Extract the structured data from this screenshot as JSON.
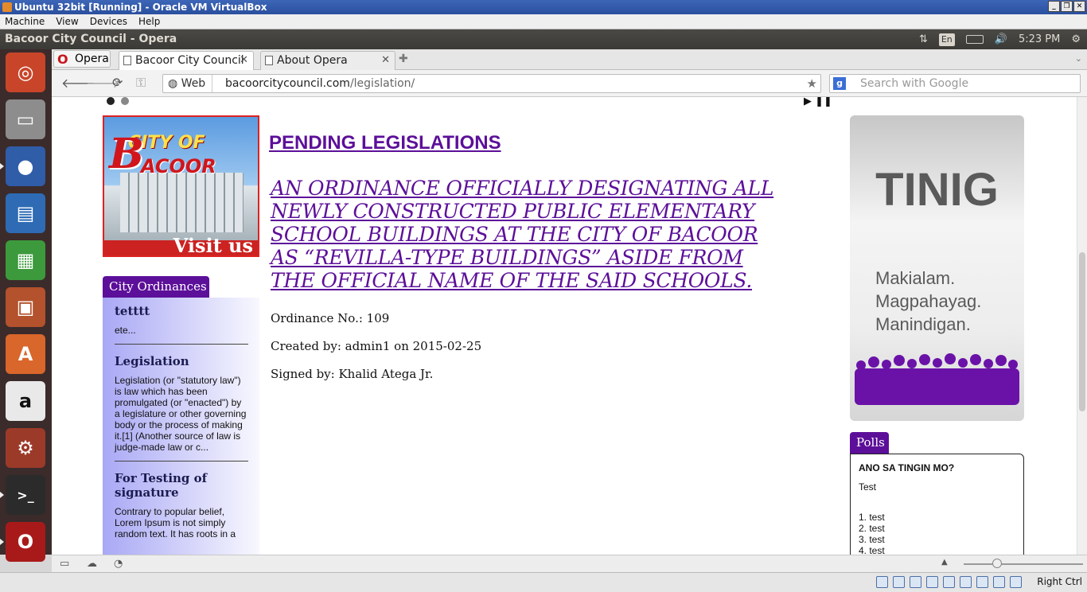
{
  "vbox": {
    "title": "Ubuntu 32bit [Running] - Oracle VM VirtualBox",
    "menu": [
      "Machine",
      "View",
      "Devices",
      "Help"
    ],
    "hostkey": "Right Ctrl"
  },
  "ubuntu": {
    "window_title": "Bacoor City Council - Opera",
    "keyboard_layout": "En",
    "clock": "5:23 PM"
  },
  "launcher": {
    "icons": [
      "ubuntu-dash-icon",
      "files-icon",
      "firefox-icon",
      "writer-icon",
      "calc-icon",
      "impress-icon",
      "software-center-icon",
      "amazon-icon",
      "system-settings-icon",
      "terminal-icon",
      "opera-icon"
    ]
  },
  "browser": {
    "menu_label": "Opera",
    "tabs": [
      {
        "label": "Bacoor City Council",
        "active": true
      },
      {
        "label": "About Opera",
        "active": false
      }
    ],
    "address": {
      "scheme_label": "Web",
      "url_host": "bacoorcitycouncil.com",
      "url_path": "/legislation/"
    },
    "search": {
      "placeholder": "Search with Google"
    }
  },
  "page": {
    "logo": {
      "line1": "CITY OF",
      "line2": "B",
      "line3": "ACOOR",
      "visit": "Visit us"
    },
    "ordinances": {
      "tab_label": "City Ordinances",
      "items": [
        {
          "title": "tetttt",
          "excerpt": "ete..."
        },
        {
          "title": "Legislation",
          "excerpt": "Legislation (or \"statutory law\") is law which has been promulgated (or \"enacted\") by a legislature or other governing body or the process of making it.[1] (Another source of law is judge-made law or c..."
        },
        {
          "title": "For Testing of signature",
          "excerpt": "Contrary to popular belief, Lorem Ipsum is not simply random text. It has roots in a"
        }
      ]
    },
    "heading": "PENDING LEGISLATIONS",
    "ordinance_title": "AN ORDINANCE OFFICIALLY DESIGNATING ALL NEWLY CONSTRUCTED PUBLIC ELEMENTARY SCHOOL BUILDINGS AT THE CITY OF BACOOR AS “REVILLA-TYPE BUILDINGS” ASIDE FROM THE OFFICIAL NAME OF THE SAID SCHOOLS.",
    "ordinance_no": "Ordinance No.: 109",
    "created_by": "Created by: admin1 on 2015-02-25",
    "signed_by": "Signed by: Khalid Atega Jr.",
    "tinig": {
      "title": "TINIG",
      "lines": [
        "Makialam.",
        "Magpahayag.",
        "Manindigan."
      ]
    },
    "polls": {
      "tab_label": "Polls",
      "question": "ANO SA TINGIN MO?",
      "description": "Test",
      "options": [
        "1. test",
        "2. test",
        "3. test",
        "4. test"
      ]
    }
  },
  "colors": {
    "accent": "#5c0f99",
    "logo_red": "#d0161c"
  }
}
